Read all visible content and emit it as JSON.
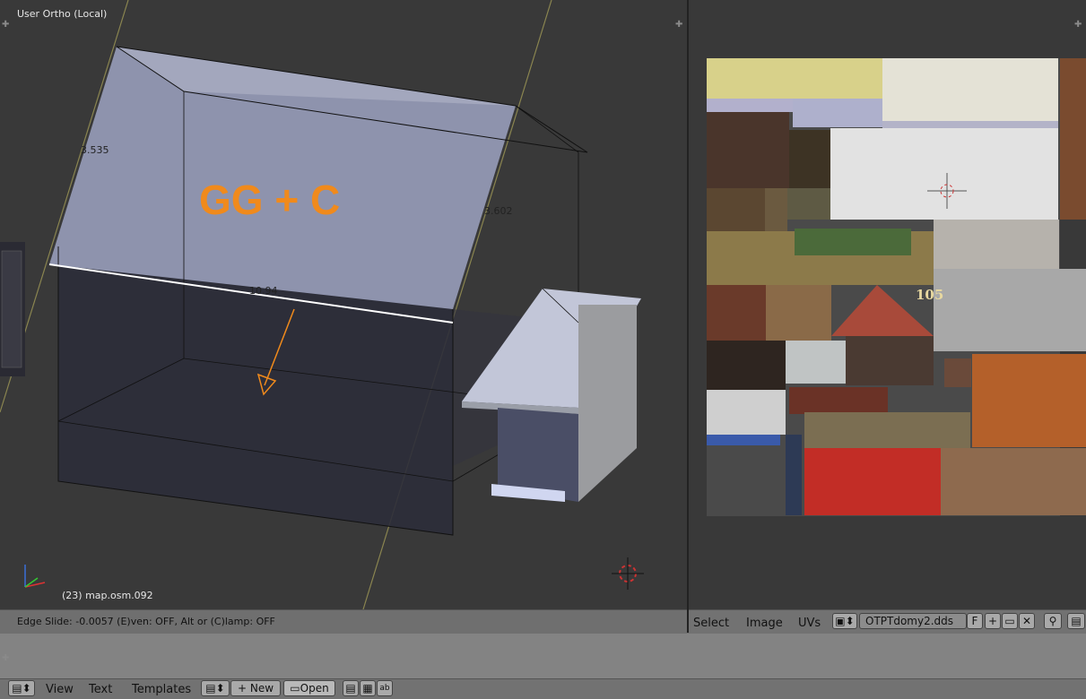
{
  "viewport": {
    "title": "User Ortho (Local)",
    "overlay_text": "GG + C",
    "object_label": "(23) map.osm.092",
    "dimensions": [
      "3.535",
      "3.602",
      "10.94"
    ]
  },
  "status_bar": {
    "text": "Edge Slide: -0.0057 (E)ven: OFF, Alt or (C)lamp: OFF"
  },
  "uv_editor": {
    "menus": [
      "Select",
      "Image",
      "UVs"
    ],
    "image_name": "OTPTdomy2.dds",
    "fake_user_label": "F",
    "texture_number": "105"
  },
  "text_editor": {
    "menus": [
      "View",
      "Text",
      "Templates"
    ],
    "new_label": "New",
    "open_label": "Open"
  },
  "colors": {
    "accent_orange": "#f08a1c",
    "viewport_bg": "#393939",
    "header_bg": "#727272"
  }
}
